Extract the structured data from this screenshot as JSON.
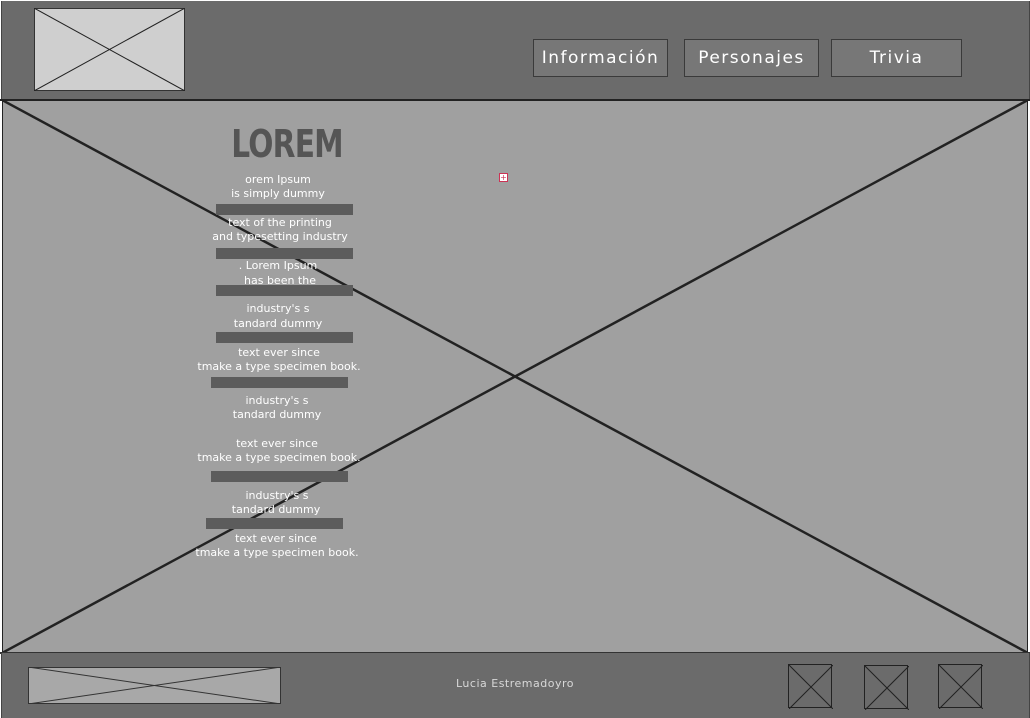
{
  "header": {
    "logo_icon": "image-placeholder-icon",
    "nav": [
      {
        "label": "Información"
      },
      {
        "label": "Personajes"
      },
      {
        "label": "Trivia"
      }
    ]
  },
  "hero": {
    "image_icon": "image-placeholder-icon",
    "title": "LOREM",
    "lines": [
      "orem Ipsum",
      "is simply dummy",
      "text of the printing",
      "and typesetting industry",
      ". Lorem Ipsum",
      "has been the",
      "industry's s",
      "tandard dummy",
      "text ever since",
      "tmake a type specimen book.",
      "industry's s",
      "tandard dummy",
      "text ever since",
      "tmake a type specimen book.",
      "industry's s",
      "tandard dummy",
      "text ever since",
      "tmake a type specimen book."
    ]
  },
  "footer": {
    "logo_icon": "image-placeholder-icon",
    "author": "Lucia Estremadoyro",
    "social_icons": [
      "image-placeholder-icon",
      "image-placeholder-icon",
      "image-placeholder-icon"
    ]
  },
  "colors": {
    "header_bg": "#6b6b6b",
    "hero_bg": "#a0a0a0",
    "title": "#555555",
    "bar": "#5c5c5c"
  }
}
